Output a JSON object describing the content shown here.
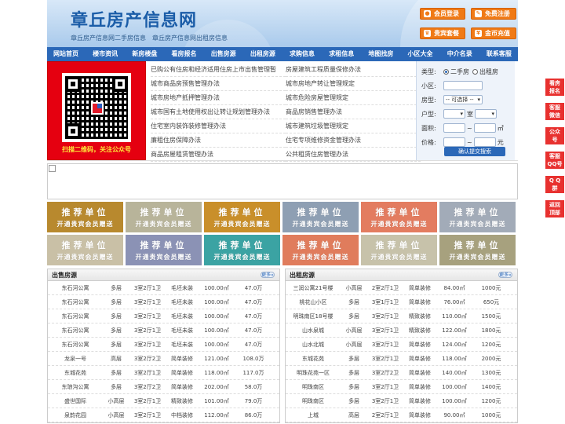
{
  "header": {
    "logo": "章丘房产信息网",
    "sub1": "章丘房产信息网二手房信息",
    "sub2": "章丘房产信息网出租房信息",
    "buttons": [
      {
        "label": "会员登录",
        "icon": "user-icon"
      },
      {
        "label": "免费注册",
        "icon": "pencil-icon"
      },
      {
        "label": "贵宾套餐",
        "icon": "crown-icon"
      },
      {
        "label": "金币充值",
        "icon": "coin-icon"
      }
    ]
  },
  "nav": [
    "网站首页",
    "楼市资讯",
    "新房楼盘",
    "看房报名",
    "出售房源",
    "出租房源",
    "求购信息",
    "求租信息",
    "地图找房",
    "小区大全",
    "中介名录",
    "联系客服"
  ],
  "qr": {
    "caption": "扫描二维码，关注公众号"
  },
  "links": [
    "已购公有住房和经济适用住房上市出售管理暂",
    "房屋建筑工程质量保修办法",
    "城市商品房预售管理办法",
    "城市房地产转让管理规定",
    "城市房地产抵押管理办法",
    "城市危险房屋管理规定",
    "城市国有土地使用权出让转让规划管理办法",
    "商品房销售管理办法",
    "住宅室内装饰装修管理办法",
    "城市建筑垃圾管理规定",
    "廉租住房保障办法",
    "住宅专项维修资金管理办法",
    "商品房屋租赁管理办法",
    "公共租赁住房管理办法"
  ],
  "search": {
    "type_label": "类型:",
    "opt1": "二手房",
    "opt2": "出租房",
    "xiaoqu": "小区:",
    "fangxing": "房型:",
    "fangxing_val": "-- 可选择 --",
    "huxing": "户型:",
    "shi": "室",
    "mianji": "面积:",
    "mianji_unit": "㎡",
    "jiage": "价格:",
    "jiage_unit": "元",
    "tilde": "~",
    "submit": "确认提交搜索"
  },
  "tile": {
    "t1": "推荐单位",
    "t2": "开通贵宾会员赠送"
  },
  "tile_colors": [
    "#b8892e",
    "#b8b49a",
    "#c98f2a",
    "#8e9fb3",
    "#e37c60",
    "#a2abb8",
    "#c9c0a6",
    "#8b92b5",
    "#3ba3a3",
    "#e07c5c",
    "#c7c2aa",
    "#a7a17e"
  ],
  "sale": {
    "title": "出售房源",
    "more": "更多»",
    "rows": [
      [
        "东石河公寓",
        "多层",
        "3室2厅1卫",
        "毛坯未装",
        "100.00㎡",
        "47.0万"
      ],
      [
        "东石河公寓",
        "多层",
        "3室2厅1卫",
        "毛坯未装",
        "100.00㎡",
        "47.0万"
      ],
      [
        "东石河公寓",
        "多层",
        "3室2厅1卫",
        "毛坯未装",
        "100.00㎡",
        "47.0万"
      ],
      [
        "东石河公寓",
        "多层",
        "3室2厅1卫",
        "毛坯未装",
        "100.00㎡",
        "47.0万"
      ],
      [
        "东石河公寓",
        "多层",
        "3室2厅1卫",
        "毛坯未装",
        "100.00㎡",
        "47.0万"
      ],
      [
        "龙泉一号",
        "高层",
        "3室2厅2卫",
        "简单装修",
        "121.00㎡",
        "108.0万"
      ],
      [
        "东城花苑",
        "多层",
        "3室2厅1卫",
        "简单装修",
        "118.00㎡",
        "117.0万"
      ],
      [
        "东琅沟公寓",
        "多层",
        "3室2厅2卫",
        "简单装修",
        "202.00㎡",
        "58.0万"
      ],
      [
        "盛世国际",
        "小高层",
        "3室2厅1卫",
        "精致装修",
        "101.00㎡",
        "79.0万"
      ],
      [
        "泉韵花园",
        "小高层",
        "3室2厅1卫",
        "中档装修",
        "112.00㎡",
        "86.0万"
      ]
    ]
  },
  "rent": {
    "title": "出租房源",
    "more": "更多»",
    "rows": [
      [
        "三润公寓21号楼",
        "小高层",
        "2室2厅1卫",
        "简单装修",
        "84.00㎡",
        "1000元"
      ],
      [
        "桃花山小区",
        "多层",
        "3室1厅1卫",
        "简单装修",
        "76.00㎡",
        "650元"
      ],
      [
        "明珠南区18号楼",
        "多层",
        "3室2厅1卫",
        "精致装修",
        "110.00㎡",
        "1500元"
      ],
      [
        "山水泉城",
        "小高层",
        "3室2厅1卫",
        "精致装修",
        "122.00㎡",
        "1800元"
      ],
      [
        "山水北城",
        "小高层",
        "3室2厅1卫",
        "简单装修",
        "124.00㎡",
        "1200元"
      ],
      [
        "东城花苑",
        "多层",
        "3室2厅1卫",
        "简单装修",
        "118.00㎡",
        "2000元"
      ],
      [
        "明珠花苑一区",
        "多层",
        "3室2厅2卫",
        "简单装修",
        "140.00㎡",
        "1300元"
      ],
      [
        "明珠南区",
        "多层",
        "3室2厅1卫",
        "简单装修",
        "100.00㎡",
        "1400元"
      ],
      [
        "明珠南区",
        "多层",
        "3室2厅1卫",
        "简单装修",
        "100.00㎡",
        "1200元"
      ],
      [
        "上城",
        "高层",
        "2室2厅1卫",
        "简单装修",
        "90.00㎡",
        "1000元"
      ]
    ]
  },
  "float": [
    [
      "看房",
      "报名"
    ],
    [
      "客服",
      "微信"
    ],
    [
      "公众",
      "号"
    ],
    [
      "客服",
      "QQ号"
    ],
    [
      "Q Q",
      "群"
    ],
    [
      "返回",
      "顶部"
    ]
  ]
}
